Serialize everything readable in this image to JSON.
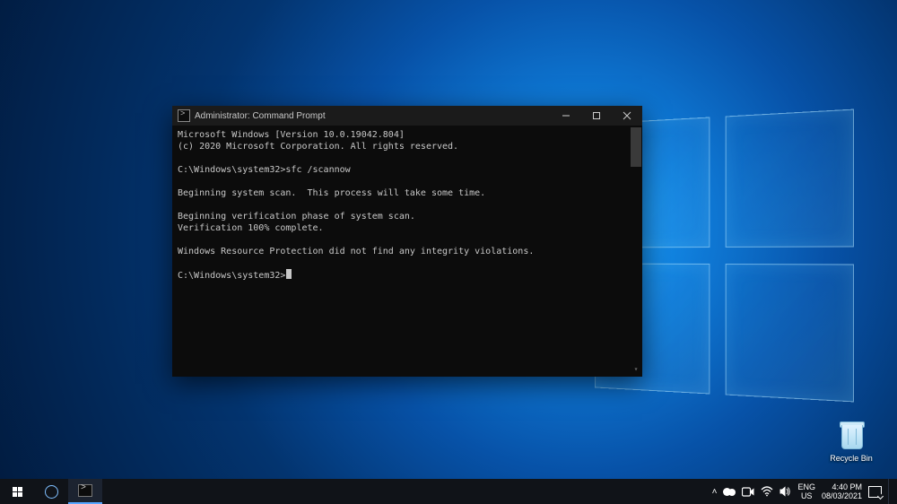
{
  "desktop": {
    "recycle_bin_label": "Recycle Bin"
  },
  "terminal": {
    "title": "Administrator: Command Prompt",
    "lines": {
      "l1": "Microsoft Windows [Version 10.0.19042.804]",
      "l2": "(c) 2020 Microsoft Corporation. All rights reserved.",
      "l3": "",
      "l4": "C:\\Windows\\system32>sfc /scannow",
      "l5": "",
      "l6": "Beginning system scan.  This process will take some time.",
      "l7": "",
      "l8": "Beginning verification phase of system scan.",
      "l9": "Verification 100% complete.",
      "l10": "",
      "l11": "Windows Resource Protection did not find any integrity violations.",
      "l12": "",
      "prompt": "C:\\Windows\\system32>"
    }
  },
  "taskbar": {
    "lang_line1": "ENG",
    "lang_line2": "US",
    "time": "4:40 PM",
    "date": "08/03/2021"
  }
}
